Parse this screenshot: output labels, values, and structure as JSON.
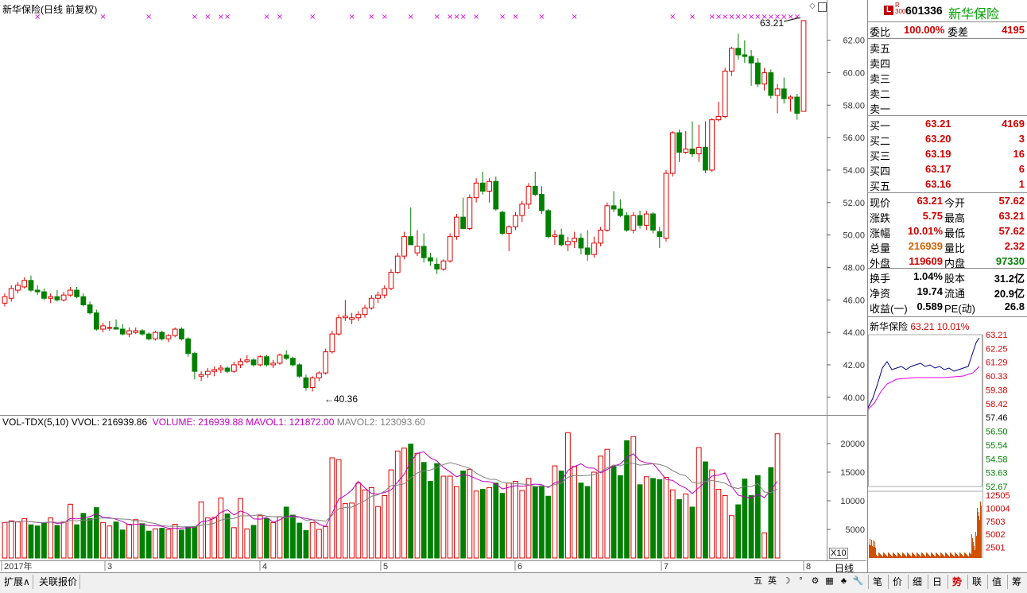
{
  "chart_title": "新华保险(日线 前复权)",
  "high_label": "63.21",
  "low_label": "40.36",
  "price_axis": [
    "62.00",
    "60.00",
    "58.00",
    "56.00",
    "54.00",
    "52.00",
    "50.00",
    "48.00",
    "46.00",
    "44.00",
    "42.00",
    "40.00"
  ],
  "vol_legend": {
    "name": "VOL-TDX(5,10)",
    "vvol": "VVOL: 216939.86",
    "volume": "VOLUME: 216939.88",
    "mavol1": "MAVOL1: 121872.00",
    "mavol2": "MAVOL2: 123093.60"
  },
  "vol_axis": [
    "20000",
    "15000",
    "10000",
    "5000"
  ],
  "vol_unit": "X10",
  "months": [
    "2017年",
    "3",
    "4",
    "5",
    "6",
    "7",
    "8"
  ],
  "period_label": "日线",
  "bottom_tabs": [
    "扩展∧",
    "关联报价"
  ],
  "stock": {
    "code": "601336",
    "name": "新华保险",
    "badge": "L",
    "badge_sub": "R 300"
  },
  "order": {
    "weibi_label": "委比",
    "weibi_value": "100.00%",
    "weicha_label": "委差",
    "weicha_value": "4195",
    "sell": [
      {
        "label": "卖五",
        "price": "",
        "vol": ""
      },
      {
        "label": "卖四",
        "price": "",
        "vol": ""
      },
      {
        "label": "卖三",
        "price": "",
        "vol": ""
      },
      {
        "label": "卖二",
        "price": "",
        "vol": ""
      },
      {
        "label": "卖一",
        "price": "",
        "vol": ""
      }
    ],
    "buy": [
      {
        "label": "买一",
        "price": "63.21",
        "vol": "4169"
      },
      {
        "label": "买二",
        "price": "63.20",
        "vol": "3"
      },
      {
        "label": "买三",
        "price": "63.19",
        "vol": "16"
      },
      {
        "label": "买四",
        "price": "63.17",
        "vol": "6"
      },
      {
        "label": "买五",
        "price": "63.16",
        "vol": "1"
      }
    ]
  },
  "quote": [
    {
      "l1": "现价",
      "v1": "63.21",
      "l2": "今开",
      "v2": "57.62",
      "c1": "red",
      "c2": "red"
    },
    {
      "l1": "涨跌",
      "v1": "5.75",
      "l2": "最高",
      "v2": "63.21",
      "c1": "red",
      "c2": "red"
    },
    {
      "l1": "涨幅",
      "v1": "10.01%",
      "l2": "最低",
      "v2": "57.62",
      "c1": "red",
      "c2": "red"
    },
    {
      "l1": "总量",
      "v1": "216939",
      "l2": "量比",
      "v2": "2.32",
      "c1": "orange",
      "c2": "red"
    },
    {
      "l1": "外盘",
      "v1": "119609",
      "l2": "内盘",
      "v2": "97330",
      "c1": "red",
      "c2": "green"
    }
  ],
  "fundamentals": [
    {
      "l1": "换手",
      "v1": "1.04%",
      "l2": "股本",
      "v2": "31.2亿"
    },
    {
      "l1": "净资",
      "v1": "19.74",
      "l2": "流通",
      "v2": "20.9亿"
    },
    {
      "l1": "收益(一)",
      "v1": "0.589",
      "l2": "PE(动)",
      "v2": "26.8"
    }
  ],
  "mini": {
    "name": "新华保险",
    "price": "63.21",
    "pct": "10.01%",
    "price_axis": [
      "63.21",
      "62.25",
      "61.29",
      "60.33",
      "59.38",
      "58.42",
      "57.46",
      "56.50",
      "55.54",
      "54.58",
      "53.63",
      "52.67"
    ],
    "vol_axis": [
      "12505",
      "10004",
      "7503",
      "5002",
      "2501"
    ]
  },
  "right_tabs": [
    "笔",
    "价",
    "细",
    "日",
    "势",
    "联",
    "值",
    "筹"
  ],
  "active_right_tab": "势",
  "tray_icons": [
    "五",
    "英",
    "☽",
    "°",
    "⚙",
    "▦",
    "♣",
    "🔧"
  ],
  "chart_data": {
    "type": "candlestick",
    "title": "新华保险(日线 前复权)",
    "ylim": [
      39.5,
      63.5
    ],
    "volume_ylim": [
      0,
      22500
    ],
    "x_month_labels": [
      "2017年",
      "3",
      "4",
      "5",
      "6",
      "7",
      "8"
    ],
    "high": 63.21,
    "low": 40.36,
    "series": [
      {
        "name": "K线",
        "ohlc": [
          [
            45.8,
            46.4,
            45.6,
            46.2
          ],
          [
            46.1,
            46.9,
            45.9,
            46.7
          ],
          [
            46.6,
            47.1,
            46.4,
            46.9
          ],
          [
            46.8,
            47.4,
            46.7,
            47.2
          ],
          [
            47.2,
            47.5,
            46.5,
            46.6
          ],
          [
            46.6,
            46.9,
            46.3,
            46.5
          ],
          [
            46.5,
            46.7,
            46.0,
            46.1
          ],
          [
            46.1,
            46.4,
            45.8,
            46.2
          ],
          [
            46.2,
            46.6,
            45.9,
            46.0
          ],
          [
            46.0,
            46.5,
            45.9,
            46.3
          ],
          [
            46.3,
            46.8,
            46.2,
            46.6
          ],
          [
            46.6,
            46.8,
            46.1,
            46.2
          ],
          [
            46.2,
            46.4,
            45.6,
            45.7
          ],
          [
            45.7,
            45.9,
            45.1,
            45.2
          ],
          [
            45.2,
            45.4,
            44.1,
            44.2
          ],
          [
            44.2,
            44.6,
            44.0,
            44.4
          ],
          [
            44.3,
            44.7,
            44.1,
            44.3
          ],
          [
            44.3,
            44.8,
            44.2,
            44.2
          ],
          [
            44.2,
            44.5,
            43.8,
            43.9
          ],
          [
            43.9,
            44.3,
            43.7,
            44.1
          ],
          [
            44.0,
            44.3,
            43.9,
            44.1
          ],
          [
            44.1,
            44.2,
            43.8,
            43.9
          ],
          [
            43.9,
            44.0,
            43.5,
            43.6
          ],
          [
            43.6,
            44.1,
            43.5,
            44.0
          ],
          [
            44.0,
            44.1,
            43.5,
            43.6
          ],
          [
            43.6,
            43.9,
            43.4,
            43.8
          ],
          [
            43.8,
            44.3,
            43.7,
            44.2
          ],
          [
            44.2,
            44.3,
            43.5,
            43.6
          ],
          [
            43.6,
            43.7,
            42.5,
            42.7
          ],
          [
            42.7,
            42.8,
            41.1,
            41.6
          ],
          [
            41.3,
            41.6,
            41.0,
            41.4
          ],
          [
            41.4,
            41.8,
            41.2,
            41.6
          ],
          [
            41.6,
            41.9,
            41.3,
            41.7
          ],
          [
            41.7,
            42.0,
            41.5,
            41.8
          ],
          [
            41.8,
            41.9,
            41.5,
            41.6
          ],
          [
            41.6,
            42.2,
            41.5,
            42.0
          ],
          [
            42.0,
            42.4,
            41.8,
            42.2
          ],
          [
            42.2,
            42.6,
            42.1,
            42.3
          ],
          [
            42.3,
            42.4,
            41.9,
            42.0
          ],
          [
            42.0,
            42.6,
            41.9,
            42.5
          ],
          [
            42.5,
            42.6,
            41.9,
            42.0
          ],
          [
            42.0,
            42.3,
            41.8,
            42.1
          ],
          [
            42.1,
            42.7,
            42.0,
            42.6
          ],
          [
            42.6,
            42.9,
            42.3,
            42.4
          ],
          [
            42.4,
            42.5,
            41.9,
            42.0
          ],
          [
            42.0,
            42.1,
            41.2,
            41.3
          ],
          [
            41.2,
            41.4,
            40.4,
            40.6
          ],
          [
            40.6,
            41.3,
            40.36,
            41.2
          ],
          [
            41.2,
            41.6,
            41.0,
            41.5
          ],
          [
            41.5,
            43.0,
            41.4,
            42.8
          ],
          [
            42.8,
            44.1,
            42.7,
            43.9
          ],
          [
            43.9,
            45.1,
            43.8,
            44.9
          ],
          [
            44.9,
            46.0,
            44.7,
            45.0
          ],
          [
            44.8,
            45.2,
            44.5,
            44.9
          ],
          [
            44.9,
            45.3,
            44.7,
            45.1
          ],
          [
            45.1,
            45.7,
            44.9,
            45.5
          ],
          [
            45.5,
            46.3,
            45.4,
            46.1
          ],
          [
            46.1,
            46.5,
            45.8,
            46.3
          ],
          [
            46.3,
            46.9,
            46.1,
            46.7
          ],
          [
            46.7,
            47.9,
            46.6,
            47.7
          ],
          [
            47.7,
            48.9,
            47.6,
            48.7
          ],
          [
            48.7,
            50.2,
            48.5,
            49.9
          ],
          [
            49.9,
            51.7,
            49.7,
            49.4
          ],
          [
            48.9,
            50.3,
            48.7,
            49.3
          ],
          [
            49.3,
            50.1,
            48.3,
            48.6
          ],
          [
            48.6,
            48.9,
            48.1,
            48.4
          ],
          [
            48.2,
            48.6,
            47.6,
            47.9
          ],
          [
            47.9,
            48.5,
            47.8,
            48.4
          ],
          [
            48.4,
            50.1,
            48.3,
            49.9
          ],
          [
            49.9,
            51.3,
            49.7,
            51.1
          ],
          [
            51.1,
            52.3,
            50.9,
            50.4
          ],
          [
            50.4,
            52.5,
            50.3,
            52.3
          ],
          [
            52.3,
            53.5,
            52.0,
            53.2
          ],
          [
            53.2,
            53.9,
            52.5,
            52.7
          ],
          [
            52.7,
            53.5,
            52.0,
            53.3
          ],
          [
            53.3,
            53.6,
            51.5,
            51.6
          ],
          [
            51.4,
            51.5,
            50.0,
            50.1
          ],
          [
            50.1,
            50.6,
            49.0,
            50.5
          ],
          [
            50.5,
            51.4,
            50.3,
            51.2
          ],
          [
            51.2,
            52.1,
            50.8,
            51.9
          ],
          [
            51.9,
            53.2,
            51.6,
            53.0
          ],
          [
            53.0,
            53.9,
            52.4,
            52.5
          ],
          [
            52.5,
            53.0,
            51.3,
            51.5
          ],
          [
            51.5,
            51.6,
            49.8,
            49.9
          ],
          [
            49.9,
            50.3,
            49.4,
            50.0
          ],
          [
            50.0,
            50.4,
            49.3,
            49.4
          ],
          [
            49.4,
            49.9,
            49.0,
            49.6
          ],
          [
            49.6,
            50.2,
            49.2,
            49.8
          ],
          [
            49.8,
            50.1,
            48.8,
            49.2
          ],
          [
            49.2,
            50.3,
            48.4,
            48.8
          ],
          [
            48.8,
            49.9,
            48.6,
            49.5
          ],
          [
            49.5,
            50.5,
            49.3,
            50.3
          ],
          [
            50.3,
            52.0,
            50.2,
            51.8
          ],
          [
            51.8,
            52.7,
            51.4,
            51.6
          ],
          [
            51.6,
            52.2,
            51.1,
            51.2
          ],
          [
            51.2,
            51.4,
            50.2,
            50.3
          ],
          [
            50.3,
            51.4,
            50.1,
            51.2
          ],
          [
            51.2,
            51.5,
            50.4,
            50.6
          ],
          [
            50.6,
            51.5,
            50.3,
            51.3
          ],
          [
            51.3,
            51.4,
            50.1,
            50.3
          ],
          [
            50.2,
            50.5,
            49.2,
            49.9
          ],
          [
            49.8,
            54.0,
            49.6,
            53.8
          ],
          [
            53.8,
            56.4,
            53.6,
            56.3
          ],
          [
            56.3,
            56.5,
            54.5,
            55.1
          ],
          [
            55.1,
            56.4,
            55.0,
            55.3
          ],
          [
            55.3,
            57.0,
            54.8,
            55.0
          ],
          [
            55.0,
            56.8,
            54.5,
            55.4
          ],
          [
            55.4,
            57.0,
            53.8,
            54.0
          ],
          [
            54.0,
            57.2,
            53.9,
            57.1
          ],
          [
            57.1,
            58.2,
            57.0,
            57.3
          ],
          [
            57.3,
            60.3,
            57.2,
            60.1
          ],
          [
            60.1,
            61.6,
            59.8,
            61.5
          ],
          [
            61.5,
            62.4,
            60.8,
            61.1
          ],
          [
            61.1,
            62.0,
            60.6,
            61.0
          ],
          [
            61.0,
            61.4,
            59.2,
            60.6
          ],
          [
            60.6,
            60.9,
            59.1,
            59.3
          ],
          [
            59.3,
            60.3,
            58.9,
            60.0
          ],
          [
            60.0,
            60.2,
            58.4,
            58.6
          ],
          [
            58.6,
            59.3,
            57.5,
            59.0
          ],
          [
            59.0,
            59.7,
            58.1,
            58.4
          ],
          [
            58.4,
            58.6,
            57.6,
            58.5
          ],
          [
            58.5,
            58.7,
            57.1,
            57.5
          ],
          [
            57.62,
            63.21,
            57.62,
            63.21
          ]
        ]
      },
      {
        "name": "VOLUME",
        "values": [
          6200,
          6500,
          6300,
          6900,
          5800,
          5600,
          6100,
          7000,
          5700,
          6300,
          9400,
          5800,
          7800,
          6900,
          8800,
          6200,
          5600,
          6300,
          4900,
          5900,
          6700,
          6000,
          4700,
          5100,
          5200,
          5000,
          5900,
          4900,
          5400,
          5500,
          9800,
          7000,
          7100,
          10500,
          7700,
          5300,
          10400,
          5100,
          5700,
          7400,
          6900,
          6200,
          7200,
          8900,
          7500,
          6100,
          4800,
          6200,
          5000,
          5500,
          17500,
          17200,
          9500,
          9600,
          13100,
          11900,
          12300,
          9000,
          10900,
          15400,
          18700,
          19200,
          19900,
          18300,
          16700,
          13400,
          16500,
          14300,
          14300,
          12500,
          15200,
          15500,
          11700,
          12000,
          12300,
          13100,
          11300,
          13100,
          13400,
          11800,
          13900,
          12400,
          12600,
          10800,
          16100,
          15200,
          21900,
          16000,
          13100,
          12500,
          15000,
          17800,
          19000,
          16000,
          14400,
          20500,
          21200,
          12800,
          14200,
          13900,
          13700,
          14100,
          11900,
          10200,
          11200,
          8900,
          19300,
          16800,
          15400,
          12000,
          10900,
          7400,
          9300,
          13800,
          10900,
          14400,
          4400,
          15800,
          21700
        ]
      },
      {
        "name": "MAVOL1",
        "values": []
      },
      {
        "name": "MAVOL2",
        "values": []
      }
    ]
  }
}
